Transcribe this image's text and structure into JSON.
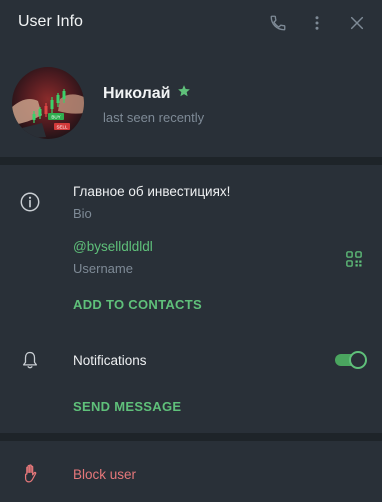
{
  "header": {
    "title": "User Info",
    "call_icon": "phone-icon",
    "menu_icon": "more-vertical-icon",
    "close_icon": "close-icon"
  },
  "profile": {
    "name": "Николай",
    "badge_icon": "star-icon",
    "status": "last seen recently",
    "avatar_image": "chart-trading-avatar",
    "avatar_buy_label": "BUY",
    "avatar_sell_label": "SELL"
  },
  "info": {
    "bio_text": "Главное об инвестициях!",
    "bio_label": "Bio",
    "bio_icon": "info-icon",
    "username": "@byselldldldl",
    "username_label": "Username",
    "qr_icon": "qr-code-icon",
    "add_contact": "ADD TO CONTACTS"
  },
  "notifications": {
    "label": "Notifications",
    "icon": "bell-icon",
    "enabled": true,
    "send_message": "SEND MESSAGE"
  },
  "block": {
    "label": "Block user",
    "icon": "hand-stop-icon"
  },
  "colors": {
    "accent": "#5fc07a",
    "danger": "#e5777a",
    "panel": "#293038",
    "divider": "#1e2429",
    "muted": "#7e8a96"
  }
}
